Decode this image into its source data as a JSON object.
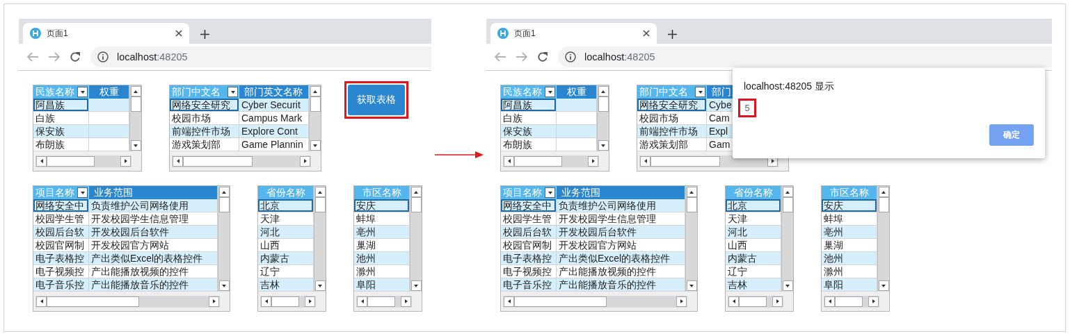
{
  "screens": [
    {
      "browser": {
        "tab": {
          "title": "页面1"
        },
        "address": {
          "host": "localhost",
          "port": ":48205"
        }
      },
      "button": {
        "label": "获取表格",
        "highlighted": true
      },
      "tables": [
        {
          "columns": [
            {
              "label": "民族名称",
              "filter": true,
              "highlighted": true
            },
            {
              "label": "权重",
              "filter": false,
              "highlighted": false
            }
          ],
          "rows": [
            {
              "cells": [
                "阿昌族"
              ],
              "selected": true
            },
            {
              "cells": [
                "白族"
              ],
              "selected": false
            },
            {
              "cells": [
                "保安族"
              ],
              "selected": false
            },
            {
              "cells": [
                "布朗族"
              ],
              "selected": false
            }
          ]
        },
        {
          "columns": [
            {
              "label": "部门中文名",
              "filter": true,
              "highlighted": true
            },
            {
              "label": "部门英文名称",
              "filter": false,
              "highlighted": false
            }
          ],
          "rows": [
            {
              "cells": [
                "网络安全研究",
                "Cyber Securit"
              ],
              "selected": true
            },
            {
              "cells": [
                "校园市场",
                "Campus Mark"
              ],
              "selected": false
            },
            {
              "cells": [
                "前端控件市场",
                "Explore Cont"
              ],
              "selected": false
            },
            {
              "cells": [
                "游戏策划部",
                "Game Plannin"
              ],
              "selected": false
            }
          ]
        },
        {
          "columns": [
            {
              "label": "项目名称",
              "filter": true,
              "highlighted": true
            },
            {
              "label": "业务范围",
              "filter": false,
              "highlighted": false
            }
          ],
          "rows": [
            {
              "cells": [
                "网络安全中",
                "负责维护公司网络使用"
              ],
              "selected": true
            },
            {
              "cells": [
                "校园学生管",
                "开发校园学生信息管理"
              ],
              "selected": false
            },
            {
              "cells": [
                "校园后台软",
                "开发校园后台软件"
              ],
              "selected": false
            },
            {
              "cells": [
                "校园官网制",
                "开发校园官方网站"
              ],
              "selected": false
            },
            {
              "cells": [
                "电子表格控",
                "产出类似Excel的表格控件"
              ],
              "selected": false
            },
            {
              "cells": [
                "电子视频控",
                "产出能播放视频的控件"
              ],
              "selected": false
            },
            {
              "cells": [
                "电子音乐控",
                "产出能播放音乐的控件"
              ],
              "selected": false
            }
          ]
        },
        {
          "columns": [
            {
              "label": "省份名称",
              "filter": false,
              "highlighted": true
            }
          ],
          "rows": [
            {
              "cells": [
                "北京"
              ],
              "selected": true
            },
            {
              "cells": [
                "天津"
              ],
              "selected": false
            },
            {
              "cells": [
                "河北"
              ],
              "selected": false
            },
            {
              "cells": [
                "山西"
              ],
              "selected": false
            },
            {
              "cells": [
                "内蒙古"
              ],
              "selected": false
            },
            {
              "cells": [
                "辽宁"
              ],
              "selected": false
            },
            {
              "cells": [
                "吉林"
              ],
              "selected": false
            }
          ]
        },
        {
          "columns": [
            {
              "label": "市区名称",
              "filter": false,
              "highlighted": true
            }
          ],
          "rows": [
            {
              "cells": [
                "安庆"
              ],
              "selected": true
            },
            {
              "cells": [
                "蚌埠"
              ],
              "selected": false
            },
            {
              "cells": [
                "亳州"
              ],
              "selected": false
            },
            {
              "cells": [
                "巢湖"
              ],
              "selected": false
            },
            {
              "cells": [
                "池州"
              ],
              "selected": false
            },
            {
              "cells": [
                "滁州"
              ],
              "selected": false
            },
            {
              "cells": [
                "阜阳"
              ],
              "selected": false
            }
          ]
        }
      ]
    },
    {
      "browser": {
        "tab": {
          "title": "页面1"
        },
        "address": {
          "host": "localhost",
          "port": ":48205"
        }
      },
      "tables": [
        {
          "columns": [
            {
              "label": "民族名称",
              "filter": true,
              "highlighted": true
            },
            {
              "label": "权重",
              "filter": false,
              "highlighted": false
            }
          ],
          "rows": [
            {
              "cells": [
                "阿昌族"
              ],
              "selected": true
            },
            {
              "cells": [
                "白族"
              ],
              "selected": false
            },
            {
              "cells": [
                "保安族"
              ],
              "selected": false
            },
            {
              "cells": [
                "布朗族"
              ],
              "selected": false
            }
          ]
        },
        {
          "columns": [
            {
              "label": "部门中文名",
              "filter": true,
              "highlighted": true
            },
            {
              "label": "部门",
              "filter": false,
              "highlighted": false
            }
          ],
          "rows": [
            {
              "cells": [
                "网络安全研究",
                "Cybe"
              ],
              "selected": true
            },
            {
              "cells": [
                "校园市场",
                "Cam"
              ],
              "selected": false
            },
            {
              "cells": [
                "前端控件市场",
                "Expl"
              ],
              "selected": false
            },
            {
              "cells": [
                "游戏策划部",
                "Gam"
              ],
              "selected": false
            }
          ]
        },
        {
          "columns": [
            {
              "label": "项目名称",
              "filter": true,
              "highlighted": true
            },
            {
              "label": "业务范围",
              "filter": false,
              "highlighted": false
            }
          ],
          "rows": [
            {
              "cells": [
                "网络安全中",
                "负责维护公司网络使用"
              ],
              "selected": true
            },
            {
              "cells": [
                "校园学生管",
                "开发校园学生信息管理"
              ],
              "selected": false
            },
            {
              "cells": [
                "校园后台软",
                "开发校园后台软件"
              ],
              "selected": false
            },
            {
              "cells": [
                "校园官网制",
                "开发校园官方网站"
              ],
              "selected": false
            },
            {
              "cells": [
                "电子表格控",
                "产出类似Excel的表格控件"
              ],
              "selected": false
            },
            {
              "cells": [
                "电子视频控",
                "产出能播放视频的控件"
              ],
              "selected": false
            },
            {
              "cells": [
                "电子音乐控",
                "产出能播放音乐的控件"
              ],
              "selected": false
            }
          ]
        },
        {
          "columns": [
            {
              "label": "省份名称",
              "filter": false,
              "highlighted": true
            }
          ],
          "rows": [
            {
              "cells": [
                "北京"
              ],
              "selected": true
            },
            {
              "cells": [
                "天津"
              ],
              "selected": false
            },
            {
              "cells": [
                "河北"
              ],
              "selected": false
            },
            {
              "cells": [
                "山西"
              ],
              "selected": false
            },
            {
              "cells": [
                "内蒙古"
              ],
              "selected": false
            },
            {
              "cells": [
                "辽宁"
              ],
              "selected": false
            },
            {
              "cells": [
                "吉林"
              ],
              "selected": false
            }
          ]
        },
        {
          "columns": [
            {
              "label": "市区名称",
              "filter": false,
              "highlighted": true
            }
          ],
          "rows": [
            {
              "cells": [
                "安庆"
              ],
              "selected": true
            },
            {
              "cells": [
                "蚌埠"
              ],
              "selected": false
            },
            {
              "cells": [
                "亳州"
              ],
              "selected": false
            },
            {
              "cells": [
                "巢湖"
              ],
              "selected": false
            },
            {
              "cells": [
                "池州"
              ],
              "selected": false
            },
            {
              "cells": [
                "滁州"
              ],
              "selected": false
            },
            {
              "cells": [
                "阜阳"
              ],
              "selected": false
            }
          ]
        }
      ],
      "dialog": {
        "title": "localhost:48205 显示",
        "message": "5",
        "message_highlighted": true,
        "button": "确定"
      }
    }
  ]
}
